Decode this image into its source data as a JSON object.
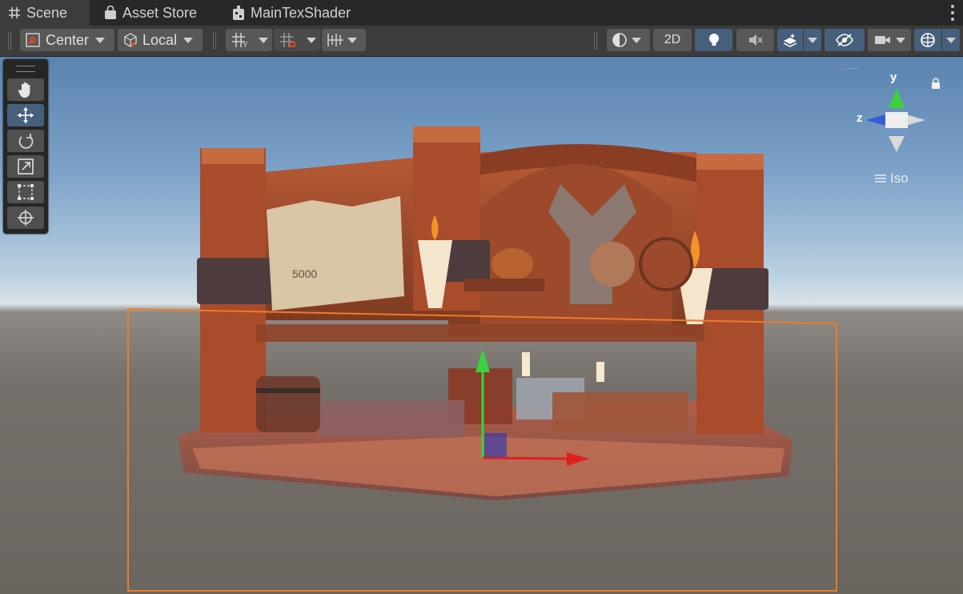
{
  "tabs": [
    {
      "label": "Scene",
      "icon": "grid-hash-icon",
      "active": true
    },
    {
      "label": "Asset Store",
      "icon": "shopping-bag-icon",
      "active": false
    },
    {
      "label": "MainTexShader",
      "icon": "shader-graph-icon",
      "active": false
    }
  ],
  "toolbar": {
    "pivot_mode": "Center",
    "pivot_rotation": "Local",
    "toggle_2d": "2D"
  },
  "orientation_gizmo": {
    "y_label": "y",
    "z_label": "z",
    "projection_label": "Iso"
  },
  "colors": {
    "accent_blue": "#46607c",
    "selection_outline": "#f07a28",
    "gizmo_x": "#e02020",
    "gizmo_y": "#3cd13c",
    "gizmo_z": "#3a5bd8"
  }
}
